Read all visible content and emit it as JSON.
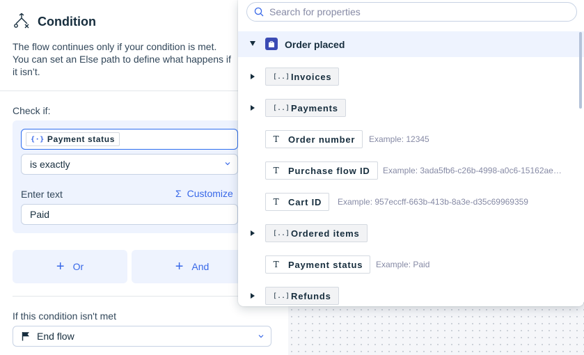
{
  "panel": {
    "title": "Condition",
    "description": "The flow continues only if your condition is met. You can set an Else path to define what happens if it isn’t.",
    "check_if_label": "Check if:",
    "field_value": "Payment status",
    "operator_value": "is exactly",
    "enter_text_label": "Enter text",
    "customize_label": "Customize",
    "text_value": "Paid",
    "or_label": "Or",
    "and_label": "And",
    "else_label": "If this condition isn't met",
    "else_value": "End flow"
  },
  "dropdown": {
    "search_placeholder": "Search for properties",
    "root_label": "Order placed",
    "items": [
      {
        "label": "Invoices",
        "type": "group",
        "icon": "[..]",
        "expandable": true,
        "example": ""
      },
      {
        "label": "Payments",
        "type": "group",
        "icon": "[..]",
        "expandable": true,
        "example": ""
      },
      {
        "label": "Order number",
        "type": "text",
        "icon": "T",
        "expandable": false,
        "example": "Example: 12345"
      },
      {
        "label": "Purchase flow ID",
        "type": "text",
        "icon": "T",
        "expandable": false,
        "example": "Example: 3ada5fb6-c26b-4998-a0c6-15162ae…"
      },
      {
        "label": "Cart ID",
        "type": "text",
        "icon": "T",
        "expandable": false,
        "example": "Example: 957eccff-663b-413b-8a3e-d35c69969359"
      },
      {
        "label": "Ordered items",
        "type": "group",
        "icon": "[..]",
        "expandable": true,
        "example": ""
      },
      {
        "label": "Payment status",
        "type": "text",
        "icon": "T",
        "expandable": false,
        "example": "Example: Paid"
      },
      {
        "label": "Refunds",
        "type": "group",
        "icon": "[..]",
        "expandable": true,
        "example": ""
      }
    ]
  },
  "colors": {
    "accent": "#3868e8",
    "text": "#162d3d",
    "highlight": "#eef3fe"
  }
}
